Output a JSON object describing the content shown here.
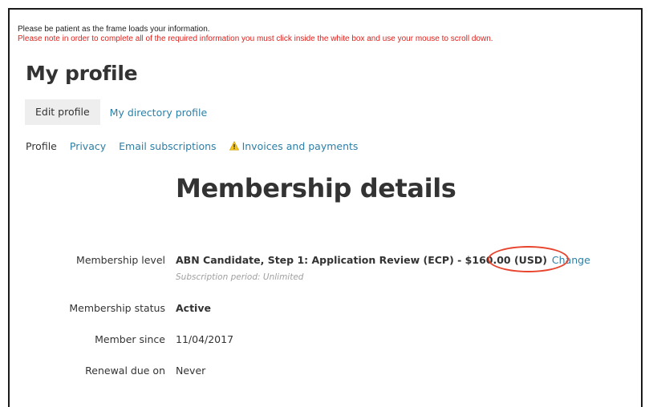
{
  "notices": {
    "loading": "Please be patient as the frame loads your information.",
    "scroll_instruction": "Please note in order to complete all of the required information you must click inside the white box and use your mouse to scroll down."
  },
  "page_title": "My profile",
  "top_tabs": [
    {
      "label": "Edit profile",
      "active": true
    },
    {
      "label": "My directory profile",
      "active": false
    }
  ],
  "sub_tabs": [
    {
      "label": "Profile",
      "current": true
    },
    {
      "label": "Privacy",
      "current": false
    },
    {
      "label": "Email subscriptions",
      "current": false
    },
    {
      "label": "Invoices and payments",
      "current": false,
      "icon": "warning-icon"
    }
  ],
  "section_title": "Membership details",
  "details": {
    "level": {
      "label": "Membership level",
      "value": "ABN Candidate, Step 1: Application Review (ECP) - $160.00 (USD)",
      "action": "Change",
      "note": "Subscription period: Unlimited"
    },
    "status": {
      "label": "Membership status",
      "value": "Active"
    },
    "since": {
      "label": "Member since",
      "value": "11/04/2017"
    },
    "renewal": {
      "label": "Renewal due on",
      "value": "Never"
    }
  },
  "colors": {
    "link": "#2c7fa6",
    "warning_text": "#e0201b",
    "highlight_circle": "#e8432c",
    "warning_icon": "#f5c518"
  }
}
